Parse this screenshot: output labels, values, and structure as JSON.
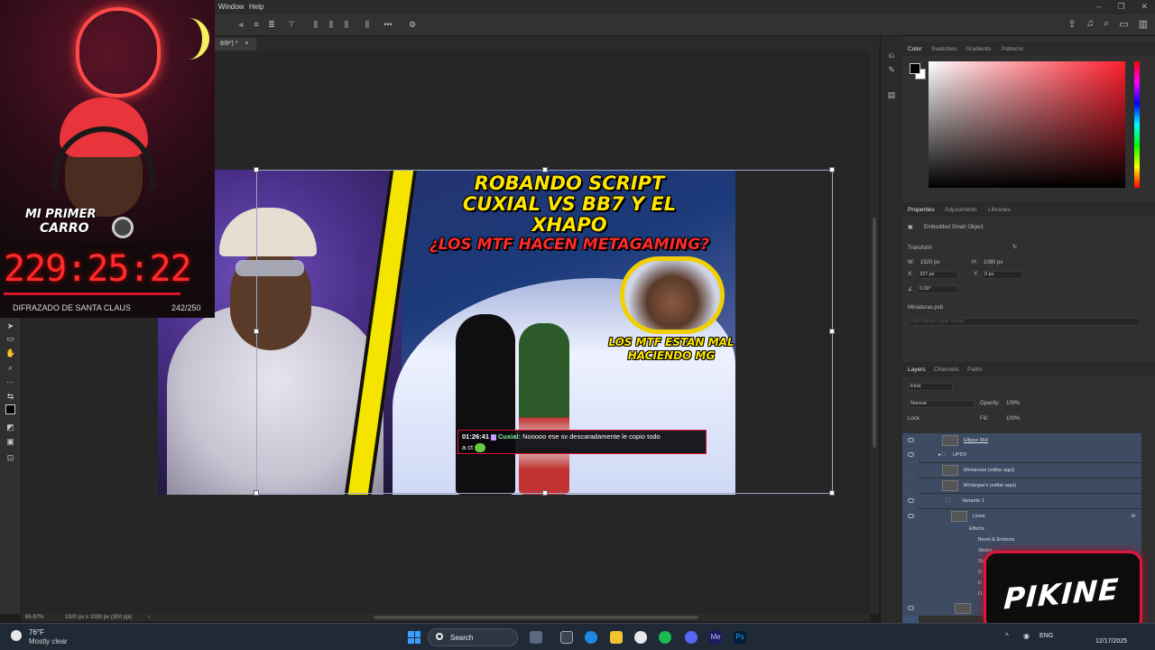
{
  "menubar": {
    "window": "Window",
    "help": "Help"
  },
  "tab": {
    "label": "8/8*) *",
    "close": "×"
  },
  "thumbnail": {
    "title_line1": "ROBANDO SCRIPT",
    "title_line2": "CUXIAL VS BB7 Y EL XHAPO",
    "title_line3": "¿LOS MTF HACEN METAGAMING?",
    "caption_line1": "LOS MTF ESTAN MAL",
    "caption_line2": "HACIENDO MG",
    "chat_time": "01:26:41",
    "chat_user": "Cuxial:",
    "chat_msg": "Nooooo ese sv descaradamente le copio todo",
    "chat_msg2": "a ct"
  },
  "webcam": {
    "badge_line1": "MI PRIMER",
    "badge_line2": "CARRO",
    "timer": "229:25:22",
    "goal_label": "DIFRAZADO DE SANTA CLAUS",
    "goal_count": "242/250"
  },
  "status": {
    "zoom": "66.67%",
    "doc_info": "1920 px x 1080 px (300 ppi)",
    "arrow": "›"
  },
  "color_panel": {
    "tabs": [
      "Color",
      "Swatches",
      "Gradients",
      "Patterns"
    ],
    "fg_color": "#000000",
    "bg_color": "#ffffff",
    "hue_color": "#ff1f2e"
  },
  "properties": {
    "tabs": [
      "Properties",
      "Adjustments",
      "Libraries"
    ],
    "object_type": "Embedded Smart Object",
    "transform_label": "Transform",
    "w_label": "W:",
    "w_value": "1920 px",
    "h_label": "H:",
    "h_value": "1080 px",
    "x_label": "X:",
    "x_value": "327 px",
    "y_label": "Y:",
    "y_value": "0 px",
    "angle_value": "0.00°",
    "file": "Miniaturas.psb",
    "comp_placeholder": "Don't Apply Layer Comp"
  },
  "layers_panel": {
    "tabs": [
      "Layers",
      "Channels",
      "Paths"
    ],
    "filter": "Kind",
    "blend_mode": "Normal",
    "opacity_label": "Opacity:",
    "opacity_value": "100%",
    "lock_label": "Lock:",
    "fill_label": "Fill:",
    "fill_value": "100%",
    "items": [
      {
        "name": "Ellipse 564"
      },
      {
        "name": "UPDV"
      },
      {
        "name": "Miniaturas (editar aqui)"
      },
      {
        "name": "MrVargas's (editar aqui)"
      },
      {
        "name": "Variante 1"
      },
      {
        "name": "Linea",
        "fx": "fx"
      },
      {
        "name": "Effects"
      },
      {
        "name": "Bevel & Emboss"
      },
      {
        "name": "Stroke"
      },
      {
        "name": "Stro"
      },
      {
        "name": "G"
      },
      {
        "name": "D"
      },
      {
        "name": "D"
      }
    ]
  },
  "logo": {
    "text": "PIKINE"
  },
  "taskbar": {
    "temp": "76°F",
    "weather": "Mostly clear",
    "search": "Search",
    "lang": "ENG",
    "time": "",
    "date": "12/17/2025"
  }
}
